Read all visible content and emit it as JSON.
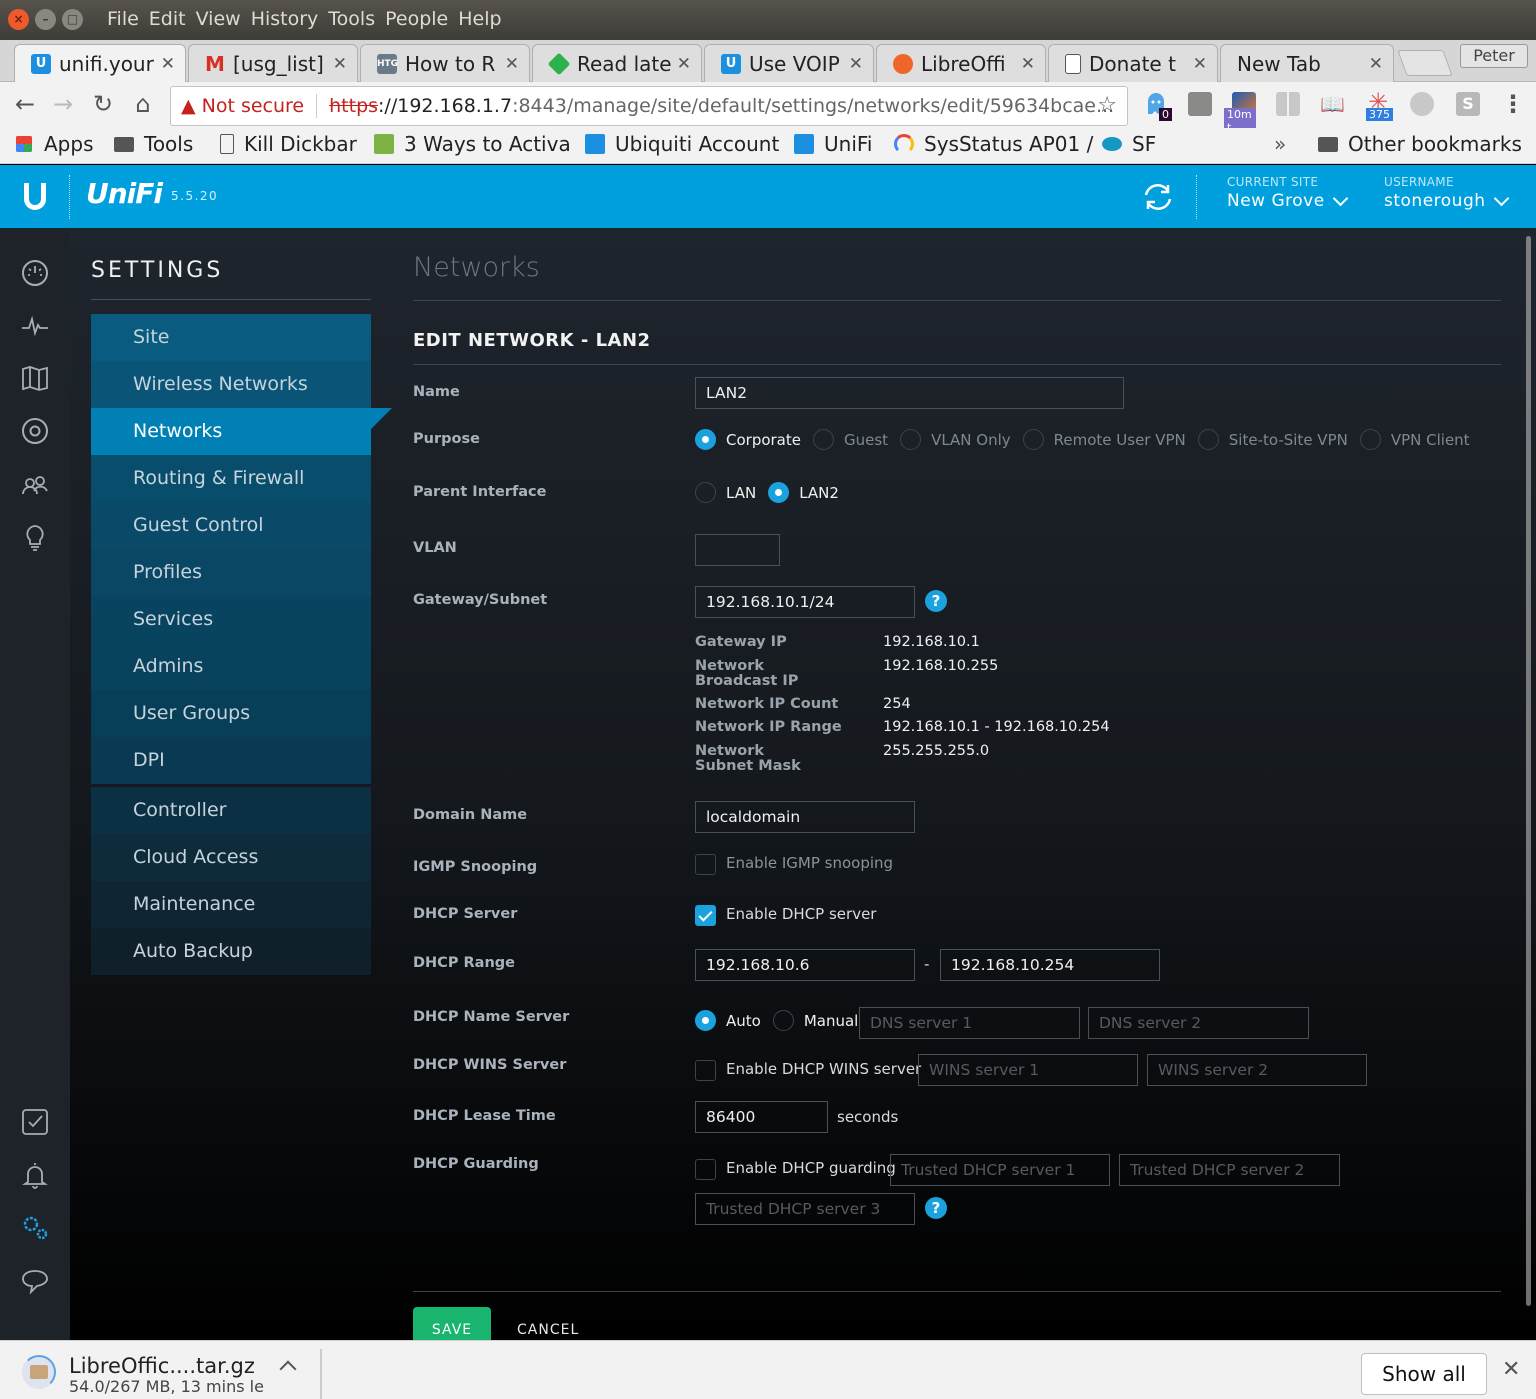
{
  "os": {
    "menus": [
      "File",
      "Edit",
      "View",
      "History",
      "Tools",
      "People",
      "Help"
    ]
  },
  "browser": {
    "tabs": [
      {
        "title": "unifi.your",
        "favicon": "unifi-icon",
        "color": "#1d8fe0",
        "active": true
      },
      {
        "title": "[usg_list]",
        "favicon": "gmail-icon",
        "color": "#d93025"
      },
      {
        "title": "How to R",
        "favicon": "htg-icon",
        "color": "#6b7a88"
      },
      {
        "title": "Read late",
        "favicon": "feedly-icon",
        "color": "#2bb24c"
      },
      {
        "title": "Use VOIP",
        "favicon": "unifi-icon",
        "color": "#1d8fe0"
      },
      {
        "title": "LibreOffi",
        "favicon": "libreoffice-icon",
        "color": "#f0652a"
      },
      {
        "title": "Donate t",
        "favicon": "page-icon",
        "color": "#ffffff"
      },
      {
        "title": "New Tab",
        "favicon": "",
        "color": ""
      }
    ],
    "profile_name": "Peter",
    "address": {
      "security_label": "Not secure",
      "scheme": "https",
      "host": "://192.168.1.7",
      "path": ":8443/manage/site/default/settings/networks/edit/59634bcae..."
    },
    "extensions": [
      {
        "name": "ghostery-icon",
        "badge": "0",
        "badge_color": "#2a0a2e"
      },
      {
        "name": "plug-icon",
        "badge": ""
      },
      {
        "name": "timer-extension-icon",
        "badge": "10m t",
        "badge_color": "#7b6fc9"
      },
      {
        "name": "grid-extension-icon",
        "badge": ""
      },
      {
        "name": "reader-icon",
        "badge": ""
      },
      {
        "name": "counter-extension-icon",
        "badge": "375",
        "badge_color": "#2f7fe0"
      },
      {
        "name": "disconnect-icon",
        "badge": ""
      },
      {
        "name": "s-extension-icon",
        "badge": ""
      }
    ],
    "bookmarks": [
      {
        "label": "Apps",
        "icon": "apps-grid-icon"
      },
      {
        "label": "Tools",
        "icon": "folder-icon"
      },
      {
        "label": "Kill Dickbar",
        "icon": "page-icon"
      },
      {
        "label": "3 Ways to Activa",
        "icon": "wikihow-icon"
      },
      {
        "label": "Ubiquiti Account",
        "icon": "unifi-icon"
      },
      {
        "label": "UniFi",
        "icon": "unifi-icon"
      },
      {
        "label": "SysStatus AP01 /",
        "icon": "rainbow-icon"
      },
      {
        "label": "SF",
        "icon": "salesforce-icon"
      }
    ],
    "bookmarks_overflow": "»",
    "other_bookmarks": "Other bookmarks"
  },
  "app": {
    "name": "UniFi",
    "version": "5.5.20",
    "current_site_label": "CURRENT SITE",
    "current_site": "New Grove",
    "username_label": "USERNAME",
    "username": "stonerough",
    "accent": "#00a0df"
  },
  "rail": {
    "top": [
      "dashboard-icon",
      "statistics-icon",
      "map-icon",
      "devices-icon",
      "clients-icon",
      "insights-icon"
    ],
    "bottom": [
      "events-icon",
      "alerts-icon",
      "settings-icon",
      "chat-icon"
    ],
    "active": "settings-icon"
  },
  "settings_nav": {
    "title": "SETTINGS",
    "groups": [
      [
        "Site",
        "Wireless Networks",
        "Networks",
        "Routing & Firewall",
        "Guest Control",
        "Profiles",
        "Services",
        "Admins",
        "User Groups",
        "DPI"
      ],
      [
        "Controller",
        "Cloud Access",
        "Maintenance",
        "Auto Backup"
      ]
    ],
    "active": "Networks"
  },
  "page": {
    "title": "Networks",
    "section_title": "EDIT NETWORK - LAN2"
  },
  "form": {
    "name": {
      "label": "Name",
      "value": "LAN2"
    },
    "purpose": {
      "label": "Purpose",
      "options": [
        "Corporate",
        "Guest",
        "VLAN Only",
        "Remote User VPN",
        "Site-to-Site VPN",
        "VPN Client"
      ],
      "selected": "Corporate"
    },
    "parent_interface": {
      "label": "Parent Interface",
      "options": [
        "LAN",
        "LAN2"
      ],
      "selected": "LAN2"
    },
    "vlan": {
      "label": "VLAN",
      "value": ""
    },
    "gateway_subnet": {
      "label": "Gateway/Subnet",
      "value": "192.168.10.1/24"
    },
    "subnet_info": [
      {
        "key": "Gateway IP",
        "value": "192.168.10.1"
      },
      {
        "key": "Network Broadcast IP",
        "value": "192.168.10.255"
      },
      {
        "key": "Network IP Count",
        "value": "254"
      },
      {
        "key": "Network IP Range",
        "value": "192.168.10.1 - 192.168.10.254"
      },
      {
        "key": "Network Subnet Mask",
        "value": "255.255.255.0"
      }
    ],
    "domain_name": {
      "label": "Domain Name",
      "value": "localdomain"
    },
    "igmp": {
      "label": "IGMP Snooping",
      "checkbox_label": "Enable IGMP snooping",
      "checked": false
    },
    "dhcp_server": {
      "label": "DHCP Server",
      "checkbox_label": "Enable DHCP server",
      "checked": true
    },
    "dhcp_range": {
      "label": "DHCP Range",
      "start": "192.168.10.6",
      "separator": "-",
      "end": "192.168.10.254"
    },
    "dhcp_name_server": {
      "label": "DHCP Name Server",
      "options": [
        "Auto",
        "Manual"
      ],
      "selected": "Auto",
      "dns1_placeholder": "DNS server 1",
      "dns2_placeholder": "DNS server 2"
    },
    "dhcp_wins": {
      "label": "DHCP WINS Server",
      "checkbox_label": "Enable DHCP WINS server",
      "checked": false,
      "wins1_placeholder": "WINS server 1",
      "wins2_placeholder": "WINS server 2"
    },
    "lease_time": {
      "label": "DHCP Lease Time",
      "value": "86400",
      "unit": "seconds"
    },
    "dhcp_guarding": {
      "label": "DHCP Guarding",
      "checkbox_label": "Enable DHCP guarding",
      "checked": false,
      "trusted1_placeholder": "Trusted DHCP server 1",
      "trusted2_placeholder": "Trusted DHCP server 2",
      "trusted3_placeholder": "Trusted DHCP server 3"
    },
    "help_glyph": "?",
    "save_label": "SAVE",
    "cancel_label": "CANCEL",
    "save_color": "#19b56f"
  },
  "downloads": {
    "file_name": "LibreOffic....tar.gz",
    "status": "54.0/267 MB, 13 mins le",
    "show_all_label": "Show all"
  }
}
